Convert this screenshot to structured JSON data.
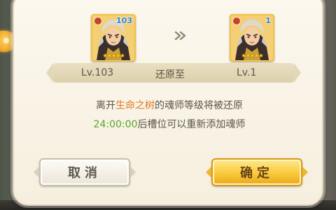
{
  "dialog": {
    "from_card": {
      "level_badge": "103",
      "stars": "★★★★★",
      "portrait": "soul-master-portrait"
    },
    "to_card": {
      "level_badge": "1",
      "stars": "★★★★★",
      "portrait": "soul-master-portrait"
    },
    "arrow_icon": "double-chevron-right-icon",
    "level_bar": {
      "from_level": "Lv.103",
      "restore_label": "还原至",
      "to_level": "Lv.1"
    },
    "message_line1": {
      "prefix": "离开",
      "highlight": "生命之树",
      "suffix": "的魂师等级将被还原"
    },
    "message_line2": {
      "time": "24:00:00",
      "suffix": "后槽位可以重新添加魂师"
    },
    "buttons": {
      "cancel": "取消",
      "confirm": "确定"
    }
  },
  "colors": {
    "highlight_orange": "#e07825",
    "highlight_green": "#55a62c",
    "confirm_button": "#f8c93c"
  }
}
